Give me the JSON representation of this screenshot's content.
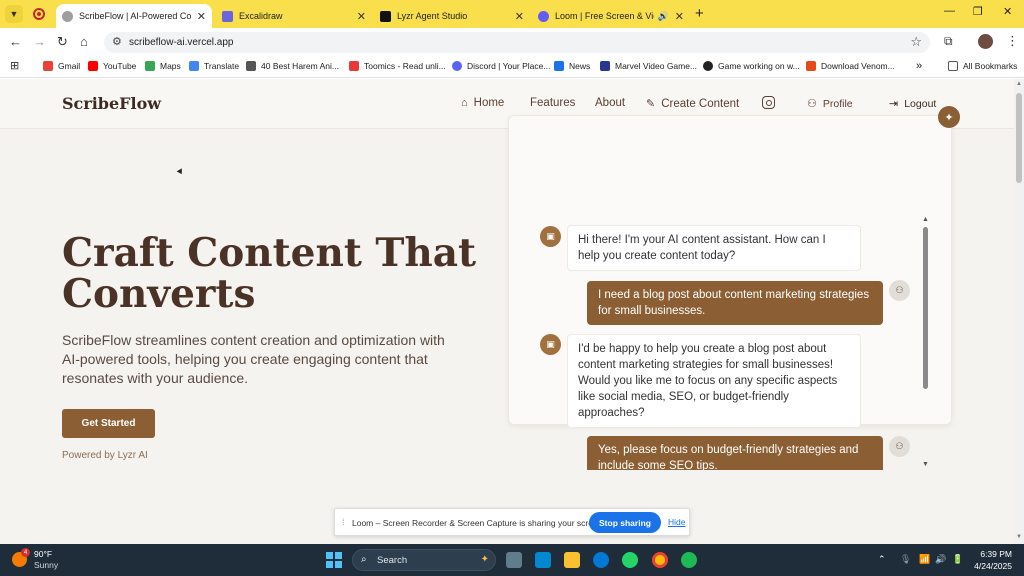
{
  "browser": {
    "tabs": [
      {
        "title": "ScribeFlow | AI-Powered Content",
        "active": true
      },
      {
        "title": "Excalidraw",
        "active": false
      },
      {
        "title": "Lyzr Agent Studio",
        "active": false
      },
      {
        "title": "Loom | Free Screen & Video",
        "active": false
      }
    ],
    "url": "scribeflow-ai.vercel.app",
    "bookmarks": [
      "Gmail",
      "YouTube",
      "Maps",
      "Translate",
      "40 Best Harem Ani...",
      "Toomics - Read unli...",
      "Discord | Your Place...",
      "News",
      "Marvel Video Game...",
      "Game working on w...",
      "Download Venom..."
    ],
    "all_bookmarks": "All Bookmarks",
    "colors": {
      "tabstrip": "#f9df4b",
      "accent": "#1a73e8"
    }
  },
  "site": {
    "logo": "ScribeFlow",
    "nav": {
      "home": "Home",
      "features": "Features",
      "about": "About",
      "create": "Create Content",
      "profile": "Profile",
      "logout": "Logout"
    },
    "hero": {
      "title": "Craft Content That Converts",
      "description": "ScribeFlow streamlines content creation and optimization with AI-powered tools, helping you create engaging content that resonates with your audience.",
      "cta": "Get Started",
      "powered": "Powered by Lyzr AI"
    },
    "chat": {
      "messages": [
        {
          "role": "bot",
          "text": "Hi there! I'm your AI content assistant. How can I help you create content today?"
        },
        {
          "role": "user",
          "text": "I need a blog post about content marketing strategies for small businesses."
        },
        {
          "role": "bot",
          "text": "I'd be happy to help you create a blog post about content marketing strategies for small businesses! Would you like me to focus on any specific aspects like social media, SEO, or budget-friendly approaches?"
        },
        {
          "role": "user",
          "text": "Yes, please focus on budget-friendly strategies and include some SEO tips."
        }
      ]
    },
    "colors": {
      "brown": "#8b5e34",
      "background": "#f5f3ef",
      "heading": "#4a3226"
    }
  },
  "loom_bar": {
    "message": "Loom – Screen Recorder & Screen Capture is sharing your screen.",
    "stop": "Stop sharing",
    "hide": "Hide"
  },
  "taskbar": {
    "weather_temp": "90°F",
    "weather_cond": "Sunny",
    "weather_badge": "4",
    "search": "Search",
    "time": "6:39 PM",
    "date": "4/24/2025"
  }
}
